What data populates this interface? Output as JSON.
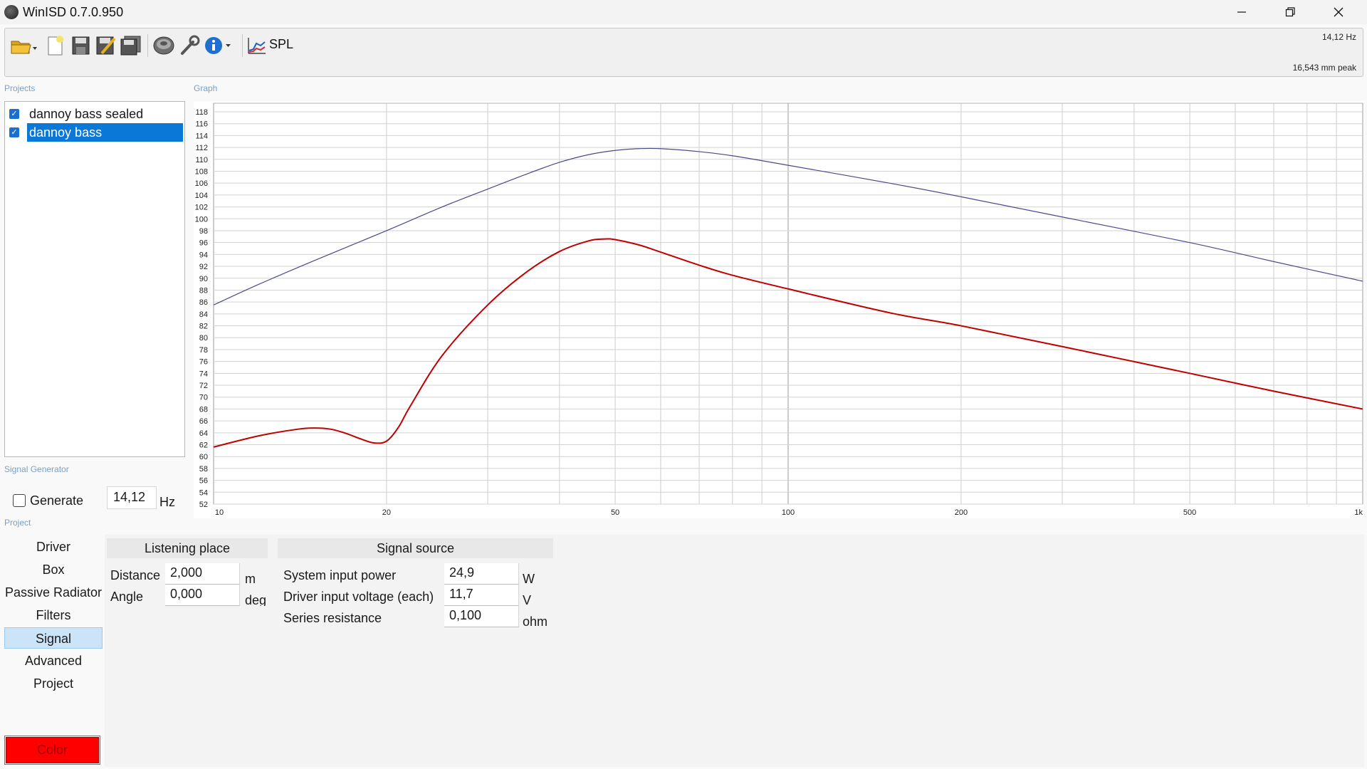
{
  "window": {
    "title": "WinISD 0.7.0.950"
  },
  "toolbar": {
    "spl_label": "SPL",
    "readout_freq": "14,12 Hz",
    "readout_excursion": "16,543 mm peak"
  },
  "sections": {
    "projects": "Projects",
    "graph": "Graph",
    "signal_generator": "Signal Generator",
    "project": "Project"
  },
  "projects": [
    {
      "name": "dannoy bass sealed",
      "checked": true,
      "selected": false,
      "color": "#4a4a8a"
    },
    {
      "name": "dannoy bass",
      "checked": true,
      "selected": true,
      "color": "#c00000"
    }
  ],
  "signal_generator": {
    "generate_label": "Generate",
    "generate_checked": false,
    "frequency_value": "14,12",
    "unit": "Hz"
  },
  "nav": {
    "items": [
      "Driver",
      "Box",
      "Passive Radiator",
      "Filters",
      "Signal",
      "Advanced",
      "Project"
    ],
    "active": "Signal",
    "color_button": "Color"
  },
  "listening_place": {
    "header": "Listening place",
    "distance_label": "Distance",
    "distance_value": "2,000",
    "distance_unit": "m",
    "angle_label": "Angle",
    "angle_value": "0,000",
    "angle_unit": "deg"
  },
  "signal_source": {
    "header": "Signal source",
    "power_label": "System input power",
    "power_value": "24,9",
    "power_unit": "W",
    "voltage_label": "Driver input voltage (each)",
    "voltage_value": "11,7",
    "voltage_unit": "V",
    "resistance_label": "Series resistance",
    "resistance_value": "0,100",
    "resistance_unit": "ohm"
  },
  "colors": {
    "accent": "#0a78d7",
    "nav_active": "#cce4f7",
    "sealed_curve": "#4a4a8a",
    "vented_curve": "#c00000",
    "color_button": "#ff0000"
  },
  "chart_data": {
    "type": "line",
    "x_scale": "log",
    "xlim": [
      10,
      1000
    ],
    "ylim": [
      52,
      118
    ],
    "x_ticks": [
      "10",
      "20",
      "50",
      "100",
      "200",
      "500",
      "1k"
    ],
    "y_ticks": [
      118,
      116,
      114,
      112,
      110,
      108,
      106,
      104,
      102,
      100,
      98,
      96,
      94,
      92,
      90,
      88,
      86,
      84,
      82,
      80,
      78,
      76,
      74,
      72,
      70,
      68,
      66,
      64,
      62,
      60,
      58,
      56,
      54,
      52
    ],
    "grid": true,
    "series": [
      {
        "name": "dannoy bass sealed",
        "color": "#4a4a8a",
        "x": [
          10,
          12,
          15,
          20,
          25,
          30,
          35,
          40,
          45,
          50,
          55,
          60,
          70,
          80,
          100,
          150,
          200,
          300,
          500,
          700,
          1000
        ],
        "y": [
          85.5,
          89,
          93,
          98,
          102,
          105,
          107.5,
          109.5,
          110.8,
          111.5,
          111.8,
          111.8,
          111.3,
          110.6,
          109,
          106,
          103.7,
          100.3,
          96,
          92.8,
          89.5
        ]
      },
      {
        "name": "dannoy bass",
        "color": "#c00000",
        "x": [
          10,
          12,
          14,
          15,
          16,
          17,
          18,
          19,
          20,
          21,
          22,
          25,
          30,
          35,
          40,
          45,
          48,
          50,
          55,
          60,
          70,
          80,
          100,
          150,
          200,
          300,
          500,
          700,
          1000
        ],
        "y": [
          61.6,
          63.5,
          64.6,
          64.8,
          64.6,
          63.9,
          63,
          62.3,
          62.6,
          65,
          68.5,
          77,
          85.5,
          91,
          94.5,
          96.3,
          96.6,
          96.5,
          95.6,
          94.4,
          92.2,
          90.5,
          88.2,
          84.2,
          82,
          78.5,
          74,
          71,
          68
        ]
      }
    ]
  }
}
